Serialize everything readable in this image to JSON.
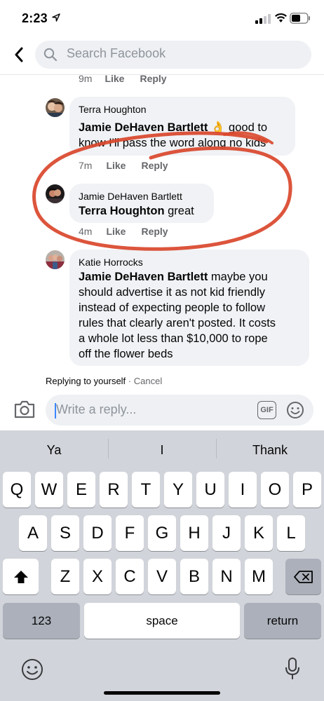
{
  "status_bar": {
    "time": "2:23"
  },
  "search": {
    "placeholder": "Search Facebook"
  },
  "comments": [
    {
      "time": "9m",
      "like": "Like",
      "reply": "Reply"
    },
    {
      "author": "Terra Houghton",
      "mention": "Jamie DeHaven Bartlett",
      "text_line1": " 👌 good to",
      "text_line2": "know I'll pass the word along no kids",
      "time": "7m",
      "like": "Like",
      "reply": "Reply"
    },
    {
      "author": "Jamie DeHaven Bartlett",
      "mention": "Terra Houghton",
      "text": " great",
      "time": "4m",
      "like": "Like",
      "reply": "Reply"
    },
    {
      "author": "Katie Horrocks",
      "mention": "Jamie DeHaven Bartlett",
      "line1": " maybe you",
      "line2": "should advertise it as not kid friendly",
      "line3": "instead of expecting people to follow",
      "line4": "rules that clearly aren't posted. It costs",
      "line5": "a whole lot less than $10,000 to rope",
      "line6": "off the flower beds"
    }
  ],
  "replying": {
    "text": "Replying to yourself",
    "separator": " · ",
    "cancel": "Cancel"
  },
  "composer": {
    "placeholder": "Write a reply...",
    "gif": "GIF"
  },
  "keyboard": {
    "suggestions": [
      "Ya",
      "I",
      "Thank"
    ],
    "row1": [
      "Q",
      "W",
      "E",
      "R",
      "T",
      "Y",
      "U",
      "I",
      "O",
      "P"
    ],
    "row2": [
      "A",
      "S",
      "D",
      "F",
      "G",
      "H",
      "J",
      "K",
      "L"
    ],
    "row3": [
      "Z",
      "X",
      "C",
      "V",
      "B",
      "N",
      "M"
    ],
    "numbers": "123",
    "space": "space",
    "return": "return"
  },
  "colors": {
    "annotation": "#d9472b",
    "accent": "#1877f2"
  }
}
